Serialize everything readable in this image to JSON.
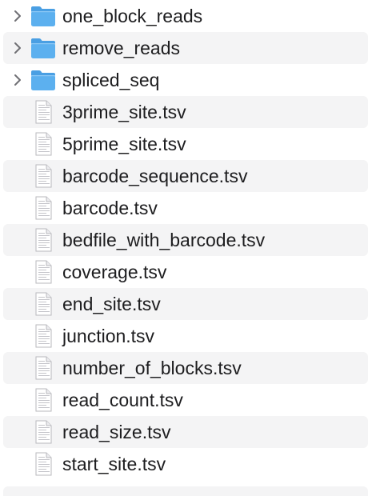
{
  "items": [
    {
      "name": "one_block_reads",
      "kind": "folder",
      "icon": "folder-icon"
    },
    {
      "name": "remove_reads",
      "kind": "folder",
      "icon": "folder-icon"
    },
    {
      "name": "spliced_seq",
      "kind": "folder",
      "icon": "folder-icon"
    },
    {
      "name": "3prime_site.tsv",
      "kind": "file",
      "icon": "document-icon"
    },
    {
      "name": "5prime_site.tsv",
      "kind": "file",
      "icon": "document-icon"
    },
    {
      "name": "barcode_sequence.tsv",
      "kind": "file",
      "icon": "document-icon"
    },
    {
      "name": "barcode.tsv",
      "kind": "file",
      "icon": "document-icon"
    },
    {
      "name": "bedfile_with_barcode.tsv",
      "kind": "file",
      "icon": "document-icon"
    },
    {
      "name": "coverage.tsv",
      "kind": "file",
      "icon": "document-icon"
    },
    {
      "name": "end_site.tsv",
      "kind": "file",
      "icon": "document-icon"
    },
    {
      "name": "junction.tsv",
      "kind": "file",
      "icon": "document-icon"
    },
    {
      "name": "number_of_blocks.tsv",
      "kind": "file",
      "icon": "document-icon"
    },
    {
      "name": "read_count.tsv",
      "kind": "file",
      "icon": "document-icon"
    },
    {
      "name": "read_size.tsv",
      "kind": "file",
      "icon": "document-icon"
    },
    {
      "name": "start_site.tsv",
      "kind": "file",
      "icon": "document-icon"
    }
  ],
  "colors": {
    "folder_body": "#5cb0ef",
    "folder_tab": "#4a9fe3",
    "stripe": "#f4f4f5",
    "text": "#1d1d1f",
    "chevron": "#6e6e73"
  }
}
